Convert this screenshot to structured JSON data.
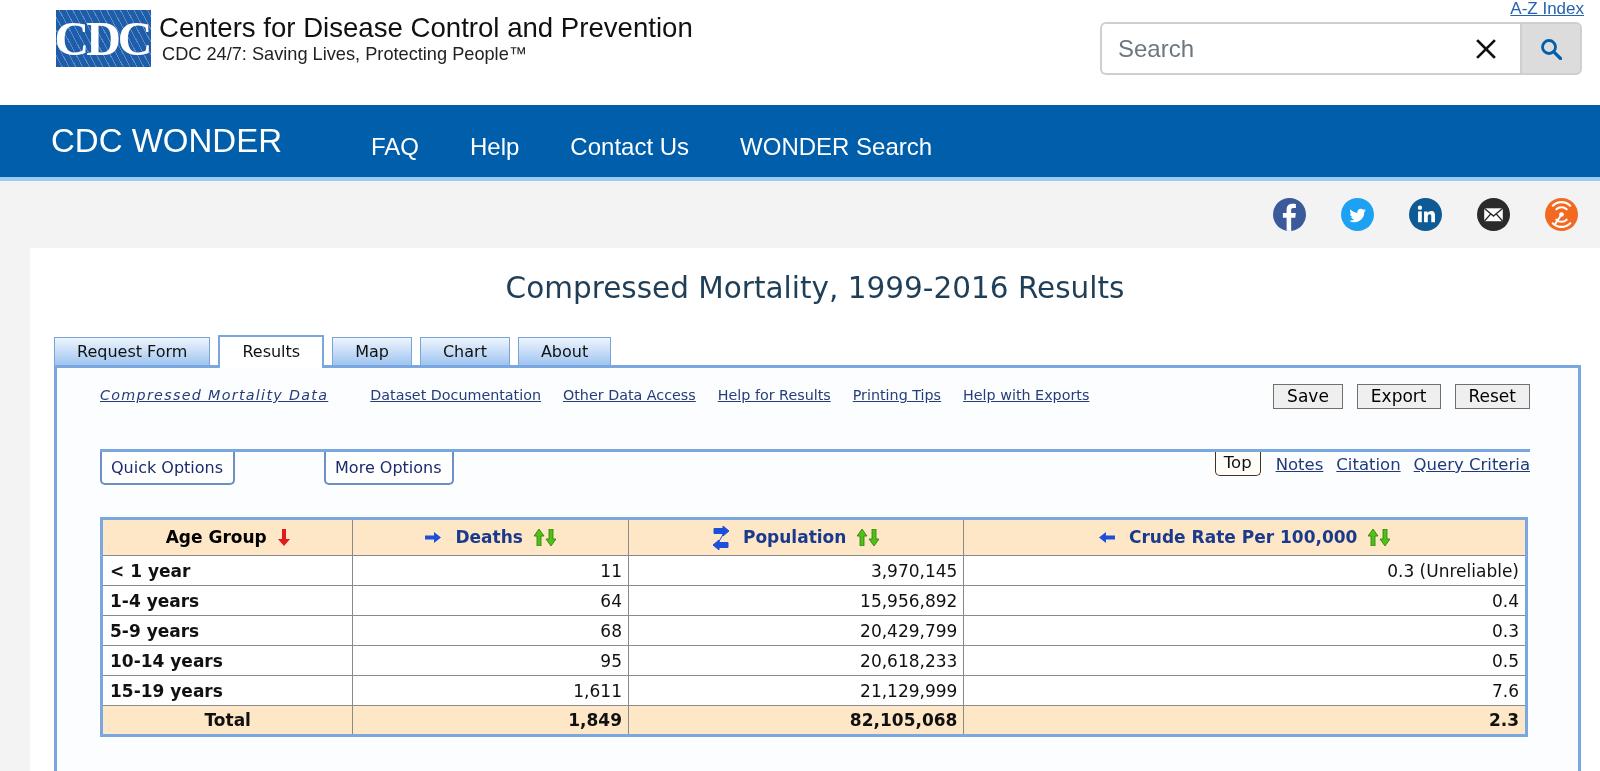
{
  "header": {
    "logo_text": "CDC",
    "org_name": "Centers for Disease Control and Prevention",
    "tagline": "CDC 24/7: Saving Lives, Protecting People™",
    "index_link": "A-Z Index",
    "search": {
      "placeholder": "Search"
    }
  },
  "navbar": {
    "brand": "CDC WONDER",
    "links": [
      "FAQ",
      "Help",
      "Contact Us",
      "WONDER Search"
    ]
  },
  "page_title": "Compressed Mortality, 1999-2016 Results",
  "tabs": [
    {
      "label": "Request Form",
      "selected": false
    },
    {
      "label": "Results",
      "selected": true
    },
    {
      "label": "Map",
      "selected": false
    },
    {
      "label": "Chart",
      "selected": false
    },
    {
      "label": "About",
      "selected": false
    }
  ],
  "resource_links": [
    {
      "label": "Compressed Mortality Data",
      "italic": true
    },
    {
      "label": "Dataset Documentation",
      "italic": false
    },
    {
      "label": "Other Data Access",
      "italic": false
    },
    {
      "label": "Help for Results",
      "italic": false
    },
    {
      "label": "Printing Tips",
      "italic": false
    },
    {
      "label": "Help with Exports",
      "italic": false
    }
  ],
  "action_buttons": [
    "Save",
    "Export",
    "Reset"
  ],
  "option_tabs": [
    "Quick Options",
    "More Options"
  ],
  "section_links": [
    {
      "label": "Top",
      "selected": true
    },
    {
      "label": "Notes",
      "selected": false
    },
    {
      "label": "Citation",
      "selected": false
    },
    {
      "label": "Query Criteria",
      "selected": false
    }
  ],
  "table": {
    "columns": [
      {
        "label": "Age Group",
        "kind": "group",
        "sorted": true,
        "movable_left": false,
        "movable_right": false
      },
      {
        "label": "Deaths",
        "kind": "measure",
        "sorted": false,
        "movable_left": false,
        "movable_right": true
      },
      {
        "label": "Population",
        "kind": "measure",
        "sorted": false,
        "movable_left": true,
        "movable_right": true
      },
      {
        "label": "Crude Rate Per 100,000",
        "kind": "measure",
        "sorted": false,
        "movable_left": true,
        "movable_right": false
      }
    ],
    "rows": [
      [
        "< 1 year",
        "11",
        "3,970,145",
        "0.3 (Unreliable)"
      ],
      [
        "1-4 years",
        "64",
        "15,956,892",
        "0.4"
      ],
      [
        "5-9 years",
        "68",
        "20,429,799",
        "0.3"
      ],
      [
        "10-14 years",
        "95",
        "20,618,233",
        "0.5"
      ],
      [
        "15-19 years",
        "1,611",
        "21,129,999",
        "7.6"
      ]
    ],
    "total": [
      "Total",
      "1,849",
      "82,105,068",
      "2.3"
    ]
  }
}
